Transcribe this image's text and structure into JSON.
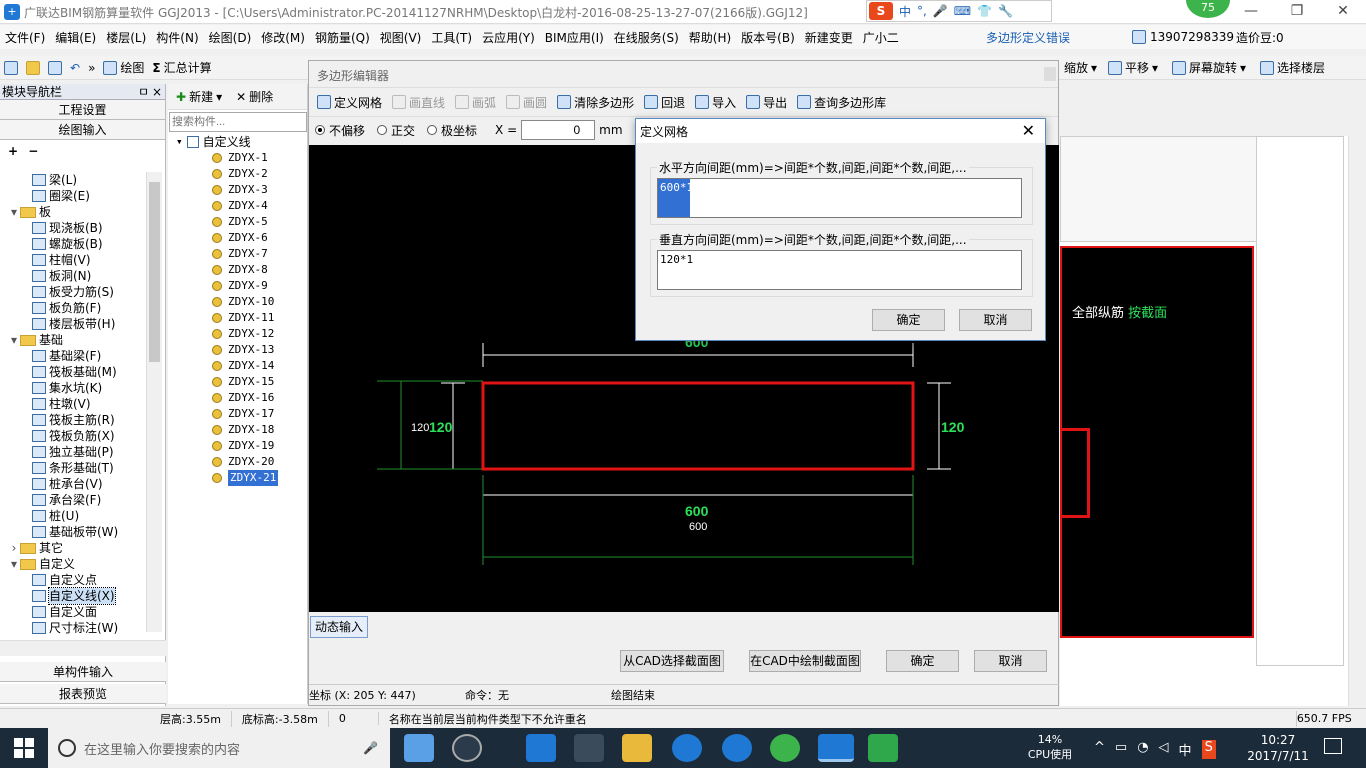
{
  "window": {
    "title": "广联达BIM钢筋算量软件 GGJ2013 - [C:\\Users\\Administrator.PC-20141127NRHM\\Desktop\\白龙村-2016-08-25-13-27-07(2166版).GGJ12]",
    "score_badge": "75"
  },
  "ime": {
    "brand": "S",
    "chinese": "中"
  },
  "menu": {
    "items": [
      "文件(F)",
      "编辑(E)",
      "楼层(L)",
      "构件(N)",
      "绘图(D)",
      "修改(M)",
      "钢筋量(Q)",
      "视图(V)",
      "工具(T)",
      "云应用(Y)",
      "BIM应用(I)",
      "在线服务(S)",
      "帮助(H)",
      "版本号(B)",
      "新建变更",
      "广小二"
    ],
    "right_notice": "多边形定义错误",
    "phone": "13907298339",
    "beans": "造价豆:0"
  },
  "toolbar": {
    "draw": "绘图",
    "summary": "汇总计算",
    "zoom": "缩放",
    "pan": "平移",
    "rotate": "屏幕旋转",
    "select_floor": "选择楼层"
  },
  "nav": {
    "header": "模块导航栏",
    "pin": "ㅁ",
    "close": "×",
    "project_settings": "工程设置",
    "drawing_input": "绘图输入",
    "single_input": "单构件输入",
    "report_preview": "报表预览",
    "tree": [
      {
        "label": "梁(L)",
        "level": 2,
        "type": "item"
      },
      {
        "label": "圈梁(E)",
        "level": 2,
        "type": "item"
      },
      {
        "label": "板",
        "level": 1,
        "type": "folder",
        "expanded": true
      },
      {
        "label": "现浇板(B)",
        "level": 2,
        "type": "item"
      },
      {
        "label": "螺旋板(B)",
        "level": 2,
        "type": "item"
      },
      {
        "label": "柱帽(V)",
        "level": 2,
        "type": "item"
      },
      {
        "label": "板洞(N)",
        "level": 2,
        "type": "item"
      },
      {
        "label": "板受力筋(S)",
        "level": 2,
        "type": "item"
      },
      {
        "label": "板负筋(F)",
        "level": 2,
        "type": "item"
      },
      {
        "label": "楼层板带(H)",
        "level": 2,
        "type": "item"
      },
      {
        "label": "基础",
        "level": 1,
        "type": "folder",
        "expanded": true
      },
      {
        "label": "基础梁(F)",
        "level": 2,
        "type": "item"
      },
      {
        "label": "筏板基础(M)",
        "level": 2,
        "type": "item"
      },
      {
        "label": "集水坑(K)",
        "level": 2,
        "type": "item"
      },
      {
        "label": "柱墩(V)",
        "level": 2,
        "type": "item"
      },
      {
        "label": "筏板主筋(R)",
        "level": 2,
        "type": "item"
      },
      {
        "label": "筏板负筋(X)",
        "level": 2,
        "type": "item"
      },
      {
        "label": "独立基础(P)",
        "level": 2,
        "type": "item"
      },
      {
        "label": "条形基础(T)",
        "level": 2,
        "type": "item"
      },
      {
        "label": "桩承台(V)",
        "level": 2,
        "type": "item"
      },
      {
        "label": "承台梁(F)",
        "level": 2,
        "type": "item"
      },
      {
        "label": "桩(U)",
        "level": 2,
        "type": "item"
      },
      {
        "label": "基础板带(W)",
        "level": 2,
        "type": "item"
      },
      {
        "label": "其它",
        "level": 1,
        "type": "folder",
        "expanded": false
      },
      {
        "label": "自定义",
        "level": 1,
        "type": "folder",
        "expanded": true
      },
      {
        "label": "自定义点",
        "level": 2,
        "type": "item"
      },
      {
        "label": "自定义线(X)",
        "level": 2,
        "type": "item",
        "selected": true
      },
      {
        "label": "自定义面",
        "level": 2,
        "type": "item"
      },
      {
        "label": "尺寸标注(W)",
        "level": 2,
        "type": "item"
      }
    ]
  },
  "component": {
    "new": "新建",
    "delete": "删除",
    "search_placeholder": "搜索构件...",
    "root": "自定义线",
    "items": [
      "ZDYX-1",
      "ZDYX-2",
      "ZDYX-3",
      "ZDYX-4",
      "ZDYX-5",
      "ZDYX-6",
      "ZDYX-7",
      "ZDYX-8",
      "ZDYX-9",
      "ZDYX-10",
      "ZDYX-11",
      "ZDYX-12",
      "ZDYX-13",
      "ZDYX-14",
      "ZDYX-15",
      "ZDYX-16",
      "ZDYX-17",
      "ZDYX-18",
      "ZDYX-19",
      "ZDYX-20",
      "ZDYX-21"
    ],
    "selected": "ZDYX-21"
  },
  "editor": {
    "title": "多边形编辑器",
    "tools": [
      "定义网格",
      "画直线",
      "画弧",
      "画圆",
      "清除多边形",
      "回退",
      "导入",
      "导出",
      "查询多边形库"
    ],
    "snap_options": [
      "不偏移",
      "正交",
      "极坐标"
    ],
    "x_label": "X =",
    "x_value": "0",
    "unit": "mm",
    "dim_top": "600",
    "dim_bottom": "600",
    "dim_bottom_small": "600",
    "dim_left_small": "120",
    "dim_left": "120",
    "dim_right": "120",
    "dynamic_input": "动态输入",
    "from_cad": "从CAD选择截面图",
    "draw_cad": "在CAD中绘制截面图",
    "ok": "确定",
    "cancel": "取消",
    "coord": "坐标 (X: 205 Y: 447)",
    "command": "命令：无",
    "status": "绘图结束"
  },
  "dialog": {
    "title": "定义网格",
    "h_label": "水平方向间距(mm)=>间距*个数,间距,间距*个数,间距,...",
    "h_value": "600*1",
    "v_label": "垂直方向间距(mm)=>间距*个数,间距,间距*个数,间距,...",
    "v_value": "120*1",
    "ok": "确定",
    "cancel": "取消"
  },
  "rightpane": {
    "text": "全部纵筋",
    "link": "按截面"
  },
  "statusbar": {
    "floor_height": "层高:3.55m",
    "bottom_elev": "底标高:-3.58m",
    "zero": "0",
    "message": "名称在当前层当前构件类型下不允许重名",
    "fps": "650.7 FPS"
  },
  "taskbar": {
    "search_placeholder": "在这里输入你要搜索的内容",
    "cpu_pct": "14%",
    "cpu_label": "CPU使用",
    "ime": "中",
    "time": "10:27",
    "date": "2017/7/11"
  },
  "colors": {
    "green": "#2de05a",
    "red": "#e01414",
    "canvas": "#000000"
  }
}
